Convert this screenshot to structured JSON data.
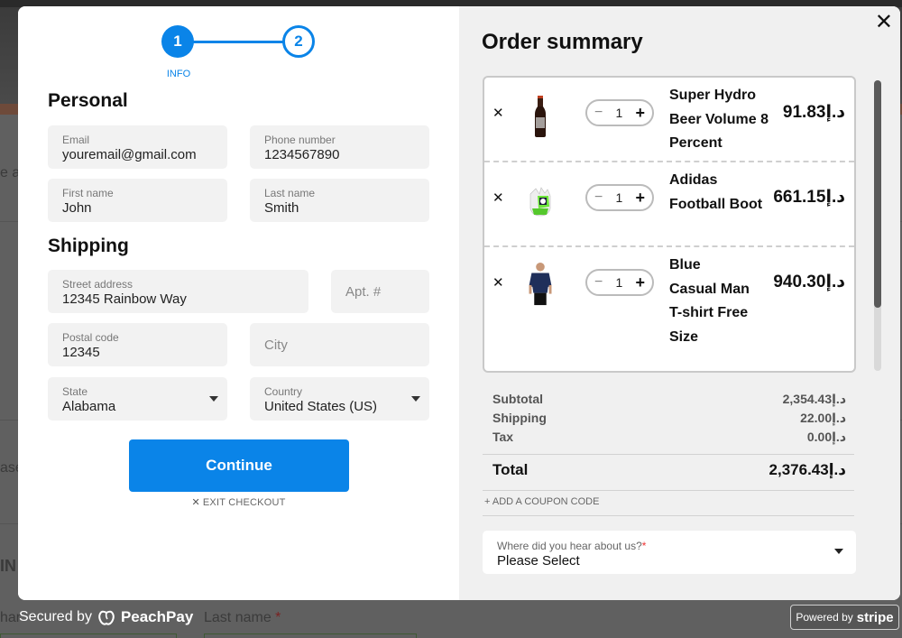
{
  "background": {
    "fragment_1": "e a",
    "fragment_2": "ase",
    "fragment_3": "IN",
    "fragment_4": "har",
    "last_name_label": "Last name",
    "required_mark": "*"
  },
  "stepper": {
    "steps": [
      {
        "number": "1",
        "label": "INFO",
        "state": "active"
      },
      {
        "number": "2",
        "label": "",
        "state": "upcoming"
      }
    ],
    "accent_color": "#0a84e8"
  },
  "personal": {
    "title": "Personal",
    "email": {
      "label": "Email",
      "value": "youremail@gmail.com"
    },
    "phone": {
      "label": "Phone number",
      "value": "1234567890"
    },
    "first_name": {
      "label": "First name",
      "value": "John"
    },
    "last_name": {
      "label": "Last name",
      "value": "Smith"
    }
  },
  "shipping": {
    "title": "Shipping",
    "street": {
      "label": "Street address",
      "value": "12345 Rainbow Way"
    },
    "apt": {
      "placeholder": "Apt. #"
    },
    "postal": {
      "label": "Postal code",
      "value": "12345"
    },
    "city": {
      "placeholder": "City"
    },
    "state": {
      "label": "State",
      "value": "Alabama"
    },
    "country": {
      "label": "Country",
      "value": "United States (US)"
    }
  },
  "actions": {
    "continue_label": "Continue",
    "exit_label": "EXIT CHECKOUT",
    "exit_icon": "✕"
  },
  "order_summary": {
    "title": "Order summary",
    "close_icon": "✕",
    "items": [
      {
        "name": "Super Hydro Beer Volume 8 Percent",
        "quantity": "1",
        "price": "91.83د.إ",
        "image": "beer-bottle"
      },
      {
        "name": "Adidas Football Boot",
        "quantity": "1",
        "price": "661.15د.إ",
        "image": "goalkeeper-glove"
      },
      {
        "name": "Blue Casual Man T-shirt Free Size",
        "quantity": "1",
        "price": "940.30د.إ",
        "image": "man-tshirt"
      }
    ],
    "qty_minus": "−",
    "qty_plus": "+",
    "remove_icon": "✕",
    "subtotal": {
      "label": "Subtotal",
      "value": "2,354.43د.إ"
    },
    "shipping": {
      "label": "Shipping",
      "value": "22.00د.إ"
    },
    "tax": {
      "label": "Tax",
      "value": "0.00د.إ"
    },
    "total": {
      "label": "Total",
      "value": "2,376.43د.إ"
    },
    "coupon_label": "+ ADD A COUPON CODE",
    "hear_about": {
      "label": "Where did you hear about us?",
      "required_mark": "*",
      "value": "Please Select"
    }
  },
  "footer": {
    "secured_by": "Secured by",
    "peachpay_brand": "PeachPay",
    "powered_by": "Powered by",
    "stripe_brand": "stripe"
  }
}
